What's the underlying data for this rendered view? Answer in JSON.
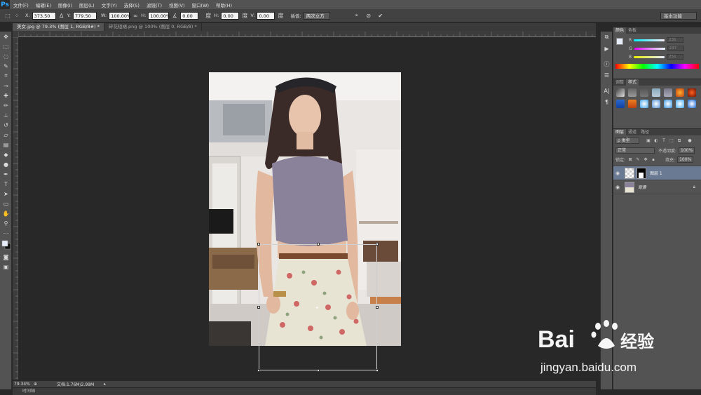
{
  "app": {
    "logo": "Ps",
    "menu": [
      "文件(F)",
      "编辑(E)",
      "图像(I)",
      "图层(L)",
      "文字(Y)",
      "选择(S)",
      "滤镜(T)",
      "视图(V)",
      "窗口(W)",
      "帮助(H)"
    ]
  },
  "options": {
    "x_label": "X:",
    "x_value": "373.50 像",
    "y_label": "Y:",
    "y_value": "779.50 像",
    "w_label": "W:",
    "w_value": "100.00%",
    "h_label": "H:",
    "h_value": "100.00%",
    "angle_value": "0.00",
    "hskew_label": "H:",
    "hskew_value": "0.00",
    "vskew_label": "V:",
    "vskew_value": "0.00",
    "interp_label": "插值:",
    "interp_value": "两次立方",
    "workspace": "基本功能"
  },
  "tabs": [
    {
      "label": "美女.jpg @ 79.3% (图层 1, RGB/8#) *",
      "active": true
    },
    {
      "label": "碎花短裙.png @ 100% (图层 0, RGB/8) *",
      "active": false
    }
  ],
  "status": {
    "zoom": "79.34%",
    "doc_info": "文档:1.76M/2.99M",
    "timeline": "时间轴"
  },
  "color_panel": {
    "tabs": [
      "颜色",
      "色板"
    ],
    "r_label": "R",
    "g_label": "G",
    "b_label": "B",
    "r_value": "231",
    "g_value": "237",
    "b_value": "251",
    "r_color": "#e7edfb"
  },
  "adjust_panel": {
    "tabs": [
      "调整",
      "样式"
    ]
  },
  "layers_panel": {
    "tabs": [
      "图层",
      "通道",
      "路径"
    ],
    "filter_label": "ρ 类型",
    "blend_mode": "正常",
    "opacity_label": "不透明度:",
    "opacity_value": "100%",
    "lock_label": "锁定:",
    "fill_label": "填充:",
    "fill_value": "100%",
    "layers": [
      {
        "name": "图层 1",
        "selected": true
      },
      {
        "name": "背景",
        "selected": false
      }
    ]
  },
  "watermark": {
    "brand": "Bai",
    "brand2": "经验",
    "url": "jingyan.baidu.com"
  }
}
